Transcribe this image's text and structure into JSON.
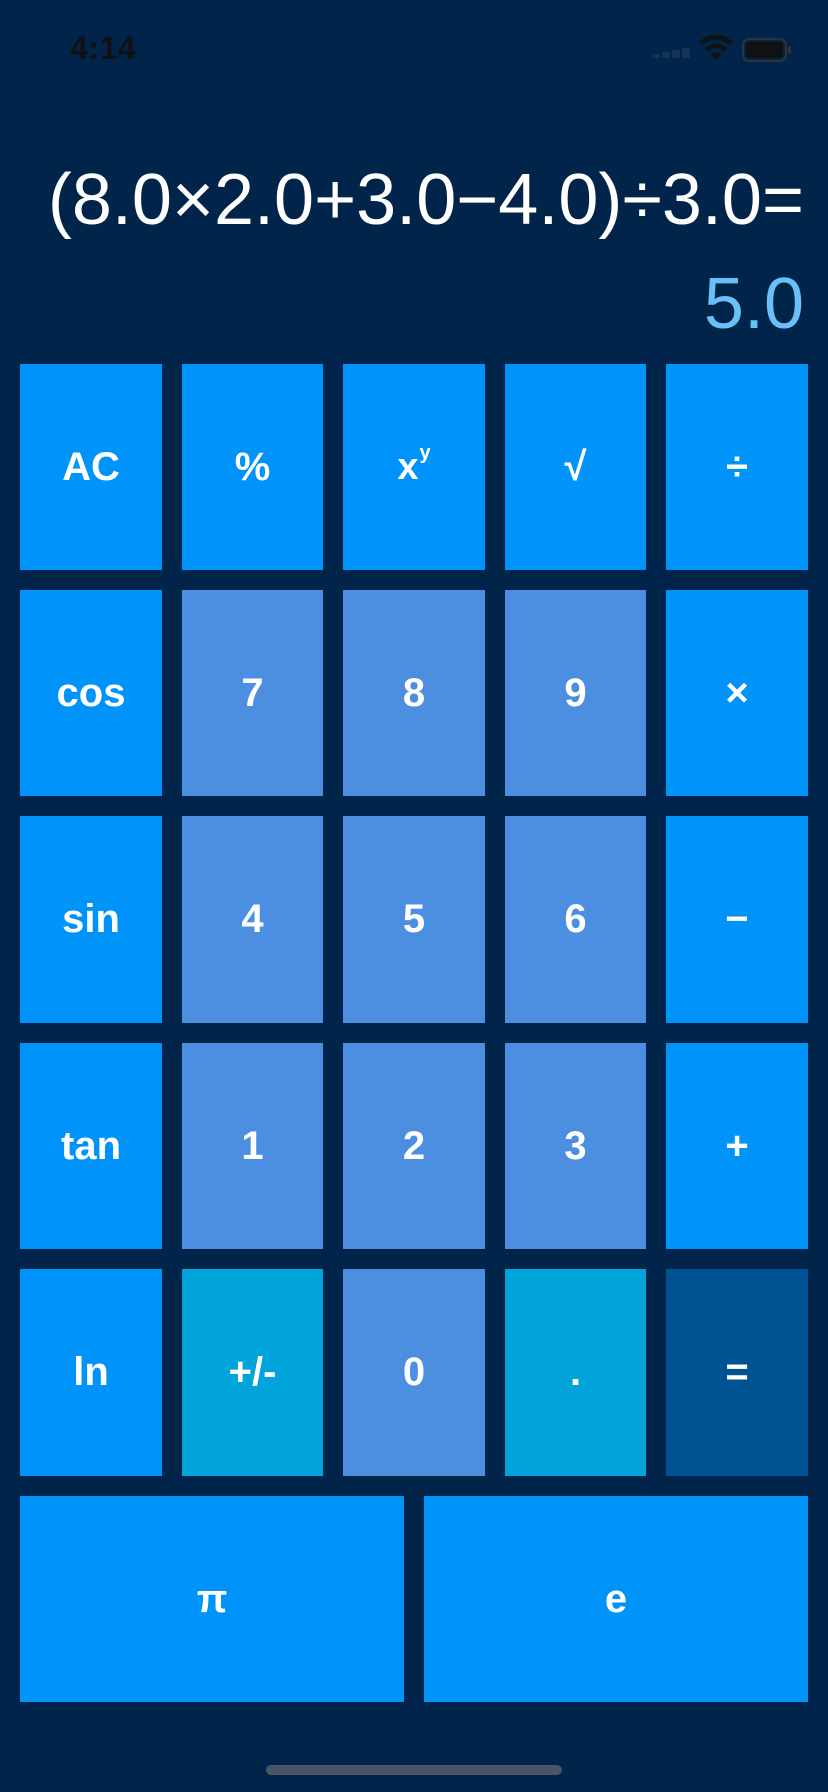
{
  "status_bar": {
    "time": "4:14",
    "wifi_icon": "wifi-icon",
    "battery_icon": "battery-icon",
    "signal_icon": "cellular-signal-icon"
  },
  "display": {
    "expression": "(8.0×2.0+3.0−4.0)÷3.0=",
    "result": "5.0"
  },
  "keypad": {
    "ac": "AC",
    "percent": "%",
    "power_base": "x",
    "power_exp": "y",
    "sqrt": "√",
    "divide": "÷",
    "cos": "cos",
    "seven": "7",
    "eight": "8",
    "nine": "9",
    "multiply": "×",
    "sin": "sin",
    "four": "4",
    "five": "5",
    "six": "6",
    "minus": "−",
    "tan": "tan",
    "one": "1",
    "two": "2",
    "three": "3",
    "plus": "+",
    "ln": "ln",
    "negate": "+/-",
    "zero": "0",
    "decimal": ".",
    "equals": "=",
    "pi": "π",
    "e": "e"
  },
  "colors": {
    "background": "#00244a",
    "operator_key": "#0093fa",
    "number_key": "#4c8fe1",
    "teal_key": "#00a4da",
    "equals_key": "#005393",
    "result_text": "#69c0f7"
  }
}
